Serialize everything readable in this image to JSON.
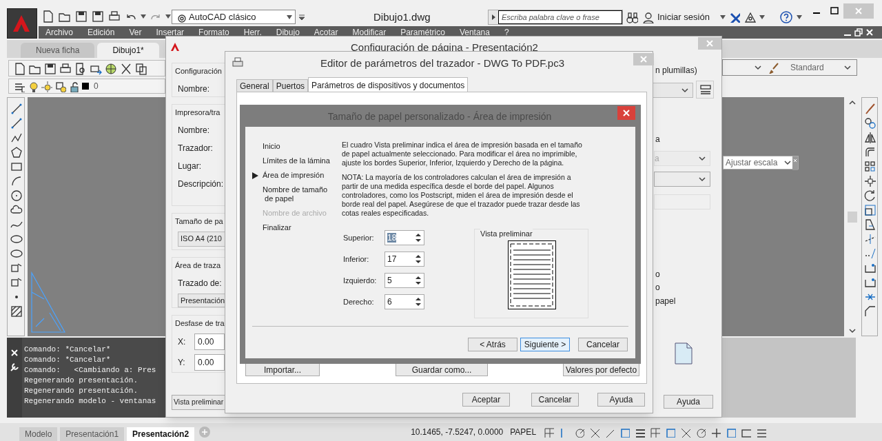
{
  "title_bar": {
    "workspace": "AutoCAD clásico",
    "document_title": "Dibujo1.dwg",
    "search_placeholder": "Escriba palabra clave o frase",
    "sign_in": "Iniciar sesión"
  },
  "menu": [
    "Archivo",
    "Edición",
    "Ver",
    "Insertar",
    "Formato",
    "Herr.",
    "Dibujo",
    "Acotar",
    "Modificar",
    "Paramétrico",
    "Ventana",
    "?"
  ],
  "file_tabs": [
    {
      "label": "Nueva ficha",
      "selected": false
    },
    {
      "label": "Dibujo1*",
      "selected": true
    }
  ],
  "layer_name": "0",
  "text_style": "Standard",
  "scale_combo": "Ajustar escala",
  "command_history": [
    "Comando: *Cancelar*",
    "Comando: *Cancelar*",
    "Comando:   <Cambiando a: Pres",
    "Regenerando presentación.",
    "Regenerando presentación.",
    "Regenerando modelo - ventanas"
  ],
  "layout_tabs": [
    {
      "label": "Modelo",
      "selected": false
    },
    {
      "label": "Presentación1",
      "selected": false
    },
    {
      "label": "Presentación2",
      "selected": true
    }
  ],
  "coordinates": "10.1465, -7.5247, 0.0000",
  "space": "PAPEL",
  "page_setup": {
    "title": "Configuración de página - Presentación2",
    "groups": [
      {
        "title": "Configuración",
        "rows": [
          {
            "kind": "label",
            "text": "Nombre:"
          }
        ]
      },
      {
        "title": "Impresora/tra",
        "rows": [
          {
            "kind": "label",
            "text": "Nombre:"
          },
          {
            "kind": "label",
            "text": "Trazador:"
          },
          {
            "kind": "label",
            "text": "Lugar:"
          },
          {
            "kind": "label",
            "text": "Descripción:"
          }
        ]
      },
      {
        "title": "Tamaño de pa",
        "rows": [
          {
            "kind": "combo",
            "text": "ISO A4 (210"
          }
        ]
      },
      {
        "title": "Área de traza",
        "rows": [
          {
            "kind": "label",
            "text": "Trazado de:"
          },
          {
            "kind": "combo",
            "text": "Presentación"
          }
        ]
      },
      {
        "title": "Desfase de tra",
        "rows": [
          {
            "kind": "field",
            "label": "X:",
            "value": "0.00"
          },
          {
            "kind": "field",
            "label": "Y:",
            "value": "0.00"
          }
        ]
      }
    ],
    "right": [
      {
        "kind": "label",
        "text": "n plumillas)",
        "disabled": false
      },
      {
        "kind": "label",
        "text": "a",
        "disabled": false
      },
      {
        "kind": "combo",
        "text": "a",
        "disabled": true
      },
      {
        "kind": "label",
        "text": "o",
        "disabled": false
      },
      {
        "kind": "label",
        "text": "o",
        "disabled": false
      },
      {
        "kind": "label",
        "text": "papel",
        "disabled": false
      }
    ],
    "preview_button": "Vista preliminar",
    "help_button": "Ayuda"
  },
  "plotter_editor": {
    "title": "Editor de parámetros del trazador - DWG To PDF.pc3",
    "tabs": [
      {
        "label": "General",
        "selected": false
      },
      {
        "label": "Puertos",
        "selected": false
      },
      {
        "label": "Parámetros de dispositivos y documentos",
        "selected": true
      }
    ],
    "panel_buttons": [
      "Importar...",
      "Guardar como...",
      "Valores por defecto"
    ],
    "buttons": [
      "Aceptar",
      "Cancelar",
      "Ayuda"
    ]
  },
  "wizard": {
    "title": "Tamaño de papel personalizado - Área de impresión",
    "steps": [
      {
        "label": "Inicio",
        "selected": false,
        "disabled": false
      },
      {
        "label": "Límites de la lámina",
        "selected": false,
        "disabled": false
      },
      {
        "label": "Área de impresión",
        "selected": true,
        "disabled": false
      },
      {
        "label": "Nombre de tamaño\n de papel",
        "selected": false,
        "disabled": false
      },
      {
        "label": "Nombre de archivo",
        "selected": false,
        "disabled": true
      },
      {
        "label": "Finalizar",
        "selected": false,
        "disabled": false
      }
    ],
    "intro": "El cuadro Vista preliminar indica el área de impresión basada en el tamaño de papel actualmente seleccionado. Para modificar el área no imprimible, ajuste los bordes Superior, Inferior, Izquierdo y Derecho de la página.",
    "note": "NOTA: La mayoría de los controladores calculan el área de impresión a partir de una medida específica desde el borde del papel. Algunos controladores, como los Postscript, miden el área de impresión desde el borde real del papel. Asegúrese de que el trazador puede trazar desde las cotas reales especificadas.",
    "margins": [
      {
        "label": "Superior:",
        "value": "18",
        "highlighted": true
      },
      {
        "label": "Inferior:",
        "value": "17",
        "highlighted": false
      },
      {
        "label": "Izquierdo:",
        "value": "5",
        "highlighted": false
      },
      {
        "label": "Derecho:",
        "value": "6",
        "highlighted": false
      }
    ],
    "preview_title": "Vista preliminar",
    "buttons": [
      {
        "label": "< Atrás",
        "focused": false
      },
      {
        "label": "Siguiente >",
        "focused": true
      },
      {
        "label": "Cancelar",
        "focused": false
      }
    ]
  }
}
